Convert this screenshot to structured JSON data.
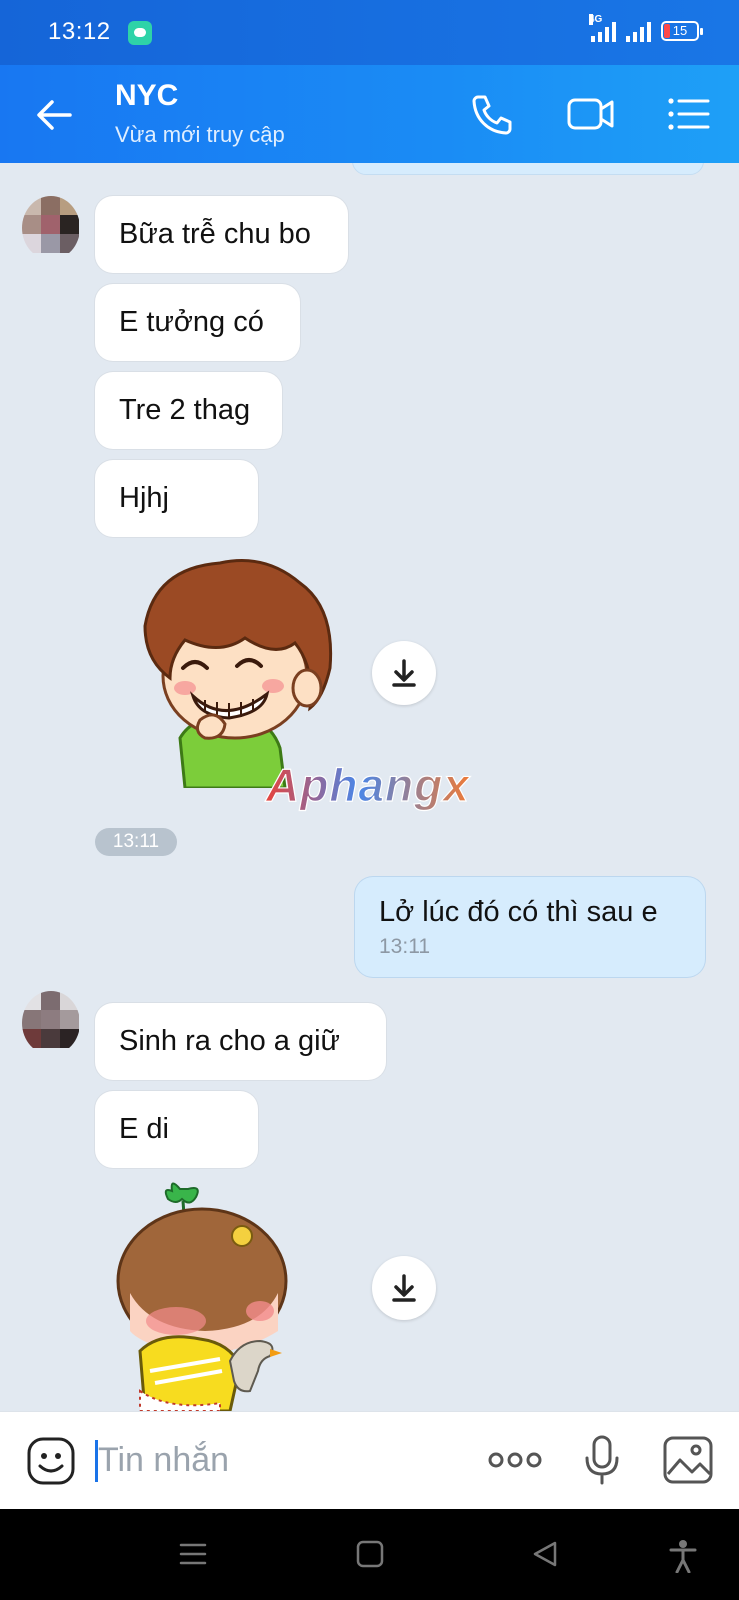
{
  "status_bar": {
    "time": "13:12",
    "network": "4G",
    "battery": "15"
  },
  "header": {
    "title": "NYC",
    "subtitle": "Vừa mới truy cập"
  },
  "messages": {
    "m1": "Bữa trễ chu bo",
    "m2": "E tưởng có",
    "m3": "Tre 2 thag",
    "m4": "Hjhj",
    "sticker1_time": "13:11",
    "mine1_text": "Lở lúc đó có thì sau e",
    "mine1_time": "13:11",
    "m5": "Sinh ra cho a giữ",
    "m6": "E di"
  },
  "watermark": "Aphangx",
  "input": {
    "placeholder": "Tin nhắn"
  },
  "colors": {
    "header": "#1877f2",
    "background": "#e2e9f1",
    "my_bubble": "#d6ecfd",
    "accent": "#1a73e8"
  },
  "icons": [
    "back-arrow-icon",
    "phone-icon",
    "video-call-icon",
    "menu-icon",
    "download-icon",
    "emoji-icon",
    "more-icon",
    "microphone-icon",
    "image-icon"
  ]
}
